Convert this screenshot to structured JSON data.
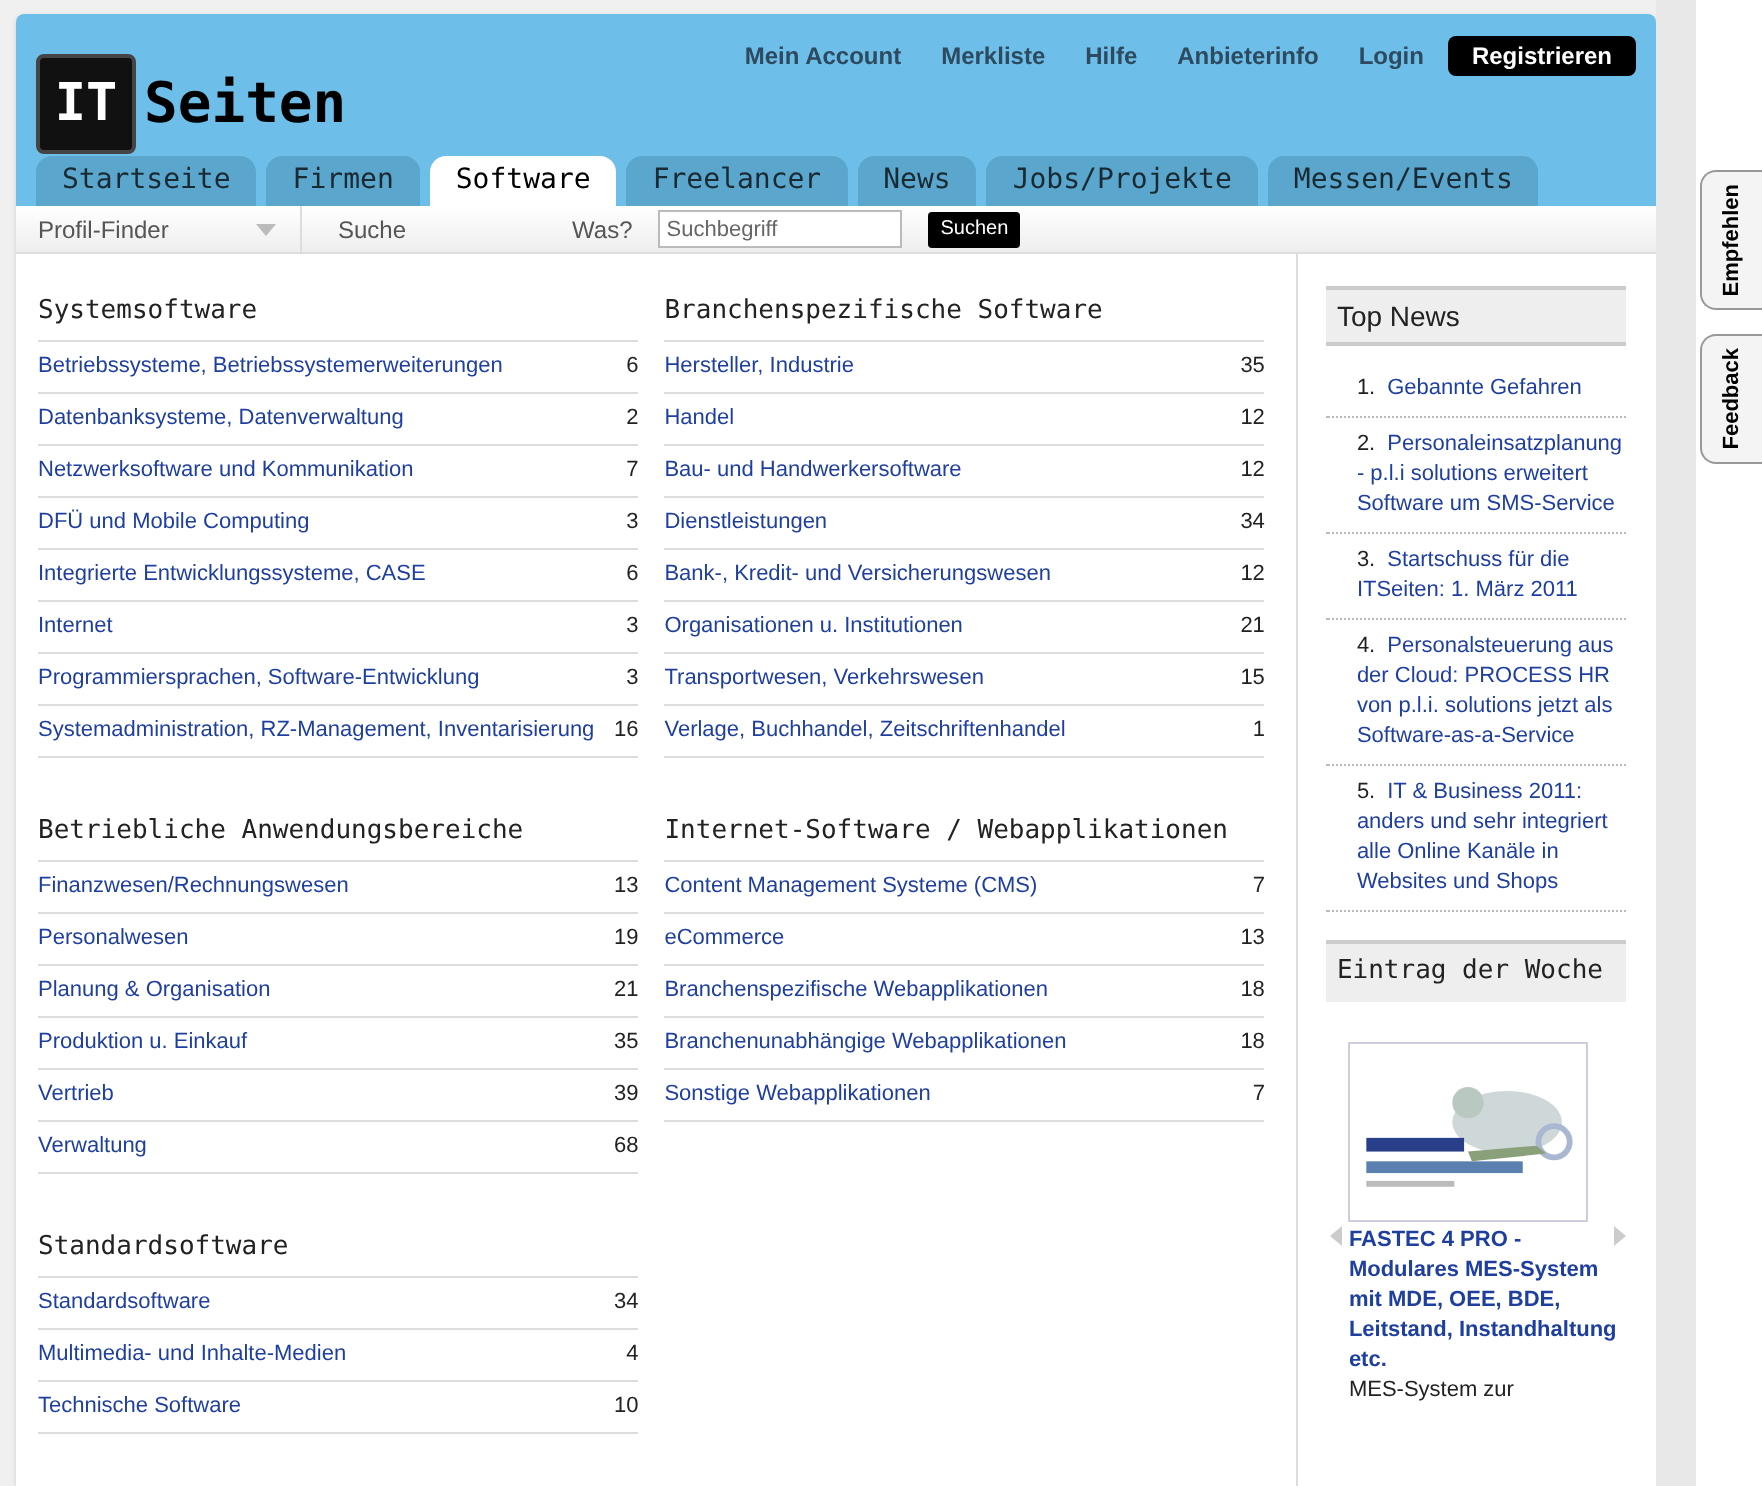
{
  "logo": {
    "box": "IT",
    "text": "Seiten"
  },
  "top_links": [
    "Mein Account",
    "Merkliste",
    "Hilfe",
    "Anbieterinfo",
    "Login"
  ],
  "register_button": "Registrieren",
  "tabs": [
    {
      "label": "Startseite",
      "selected": false
    },
    {
      "label": "Firmen",
      "selected": false
    },
    {
      "label": "Software",
      "selected": true
    },
    {
      "label": "Freelancer",
      "selected": false
    },
    {
      "label": "News",
      "selected": false
    },
    {
      "label": "Jobs/Projekte",
      "selected": false
    },
    {
      "label": "Messen/Events",
      "selected": false
    }
  ],
  "subnav": {
    "profile_finder": "Profil-Finder",
    "search_label": "Suche",
    "what_label": "Was?",
    "search_placeholder": "Suchbegriff",
    "search_button": "Suchen"
  },
  "columns": [
    [
      {
        "title": "Systemsoftware",
        "items": [
          {
            "label": "Betriebssysteme, Betriebssystemerweiterungen",
            "count": "6"
          },
          {
            "label": "Datenbanksysteme, Datenverwaltung",
            "count": "2"
          },
          {
            "label": "Netzwerksoftware und Kommunikation",
            "count": "7"
          },
          {
            "label": "DFÜ und Mobile Computing",
            "count": "3"
          },
          {
            "label": "Integrierte Entwicklungssysteme, CASE",
            "count": "6"
          },
          {
            "label": "Internet",
            "count": "3"
          },
          {
            "label": "Programmiersprachen, Software-Entwicklung",
            "count": "3"
          },
          {
            "label": "Systemadministration, RZ-Management, Inventarisierung",
            "count": "16"
          }
        ]
      },
      {
        "title": "Betriebliche Anwendungsbereiche",
        "items": [
          {
            "label": "Finanzwesen/Rechnungswesen",
            "count": "13"
          },
          {
            "label": "Personalwesen",
            "count": "19"
          },
          {
            "label": "Planung & Organisation",
            "count": "21"
          },
          {
            "label": "Produktion u. Einkauf",
            "count": "35"
          },
          {
            "label": "Vertrieb",
            "count": "39"
          },
          {
            "label": "Verwaltung",
            "count": "68"
          }
        ]
      },
      {
        "title": "Standardsoftware",
        "items": [
          {
            "label": "Standardsoftware",
            "count": "34"
          },
          {
            "label": "Multimedia- und Inhalte-Medien",
            "count": "4"
          },
          {
            "label": "Technische Software",
            "count": "10"
          }
        ]
      }
    ],
    [
      {
        "title": "Branchenspezifische Software",
        "items": [
          {
            "label": "Hersteller, Industrie",
            "count": "35"
          },
          {
            "label": "Handel",
            "count": "12"
          },
          {
            "label": "Bau- und Handwerkersoftware",
            "count": "12"
          },
          {
            "label": "Dienstleistungen",
            "count": "34"
          },
          {
            "label": "Bank-, Kredit- und Versicherungswesen",
            "count": "12"
          },
          {
            "label": "Organisationen u. Institutionen",
            "count": "21"
          },
          {
            "label": "Transportwesen, Verkehrswesen",
            "count": "15"
          },
          {
            "label": "Verlage, Buchhandel, Zeitschriftenhandel",
            "count": "1"
          }
        ]
      },
      {
        "title": "Internet-Software / Webapplikationen",
        "items": [
          {
            "label": "Content Management Systeme (CMS)",
            "count": "7"
          },
          {
            "label": "eCommerce",
            "count": "13"
          },
          {
            "label": "Branchenspezifische Webapplikationen",
            "count": "18"
          },
          {
            "label": "Branchenunabhängige Webapplikationen",
            "count": "18"
          },
          {
            "label": "Sonstige Webapplikationen",
            "count": "7"
          }
        ]
      }
    ]
  ],
  "top_news": {
    "title": "Top News",
    "items": [
      {
        "number": "1.",
        "text": "Gebannte Gefahren"
      },
      {
        "number": "2.",
        "text": "Personaleinsatzplanung - p.l.i solutions erweitert Software um SMS-Service"
      },
      {
        "number": "3.",
        "text": "Startschuss für die ITSeiten: 1. März 2011"
      },
      {
        "number": "4.",
        "text": "Personalsteuerung aus der Cloud: PROCESS HR von p.l.i. solutions jetzt als Software-as-a-Service"
      },
      {
        "number": "5.",
        "text": "IT & Business 2011: anders und sehr integriert alle Online Kanäle in Websites und Shops"
      }
    ]
  },
  "entry_of_week": {
    "title": "Eintrag der Woche",
    "link": "FASTEC 4 PRO - Modulares MES-System mit MDE, OEE, BDE, Leitstand, Instandhaltung etc.",
    "description": "MES-System zur"
  },
  "side_tabs": [
    "Empfehlen",
    "Feedback"
  ]
}
